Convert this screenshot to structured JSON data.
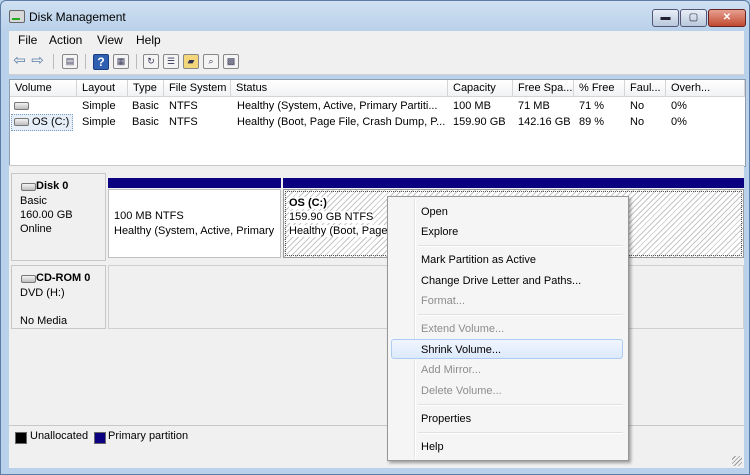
{
  "window": {
    "title": "Disk Management",
    "controls": {
      "minimize": "▬",
      "maximize": "▢",
      "close": "✕"
    }
  },
  "menu": [
    "File",
    "Action",
    "View",
    "Help"
  ],
  "toolbar_icons": [
    "back-arrow-icon",
    "forward-arrow-icon",
    "console-tree-icon",
    "help-icon",
    "refresh-icon",
    "properties-icon",
    "open-folder-icon",
    "search-icon",
    "disk-settings-icon"
  ],
  "volume_list": {
    "columns": [
      "Volume",
      "Layout",
      "Type",
      "File System",
      "Status",
      "Capacity",
      "Free Spa...",
      "% Free",
      "Faul...",
      "Overh..."
    ],
    "rows": [
      {
        "volume": "",
        "layout": "Simple",
        "type": "Basic",
        "fs": "NTFS",
        "status": "Healthy (System, Active, Primary Partiti...",
        "capacity": "100 MB",
        "free": "71 MB",
        "pct": "71 %",
        "fault": "No",
        "overhead": "0%"
      },
      {
        "volume": "OS (C:)",
        "layout": "Simple",
        "type": "Basic",
        "fs": "NTFS",
        "status": "Healthy (Boot, Page File, Crash Dump, P...",
        "capacity": "159.90 GB",
        "free": "142.16 GB",
        "pct": "89 %",
        "fault": "No",
        "overhead": "0%"
      }
    ]
  },
  "disks": [
    {
      "name": "Disk 0",
      "type": "Basic",
      "size": "160.00 GB",
      "state": "Online",
      "partitions": [
        {
          "name": "",
          "size": "100 MB NTFS",
          "status": "Healthy (System, Active, Primary"
        },
        {
          "name": "OS  (C:)",
          "size": "159.90 GB NTFS",
          "status": "Healthy (Boot, Page"
        }
      ]
    },
    {
      "name": "CD-ROM 0",
      "type": "DVD (H:)",
      "state": "No Media"
    }
  ],
  "legend": [
    {
      "label": "Unallocated",
      "color": "#000000"
    },
    {
      "label": "Primary partition",
      "color": "#0a0080"
    }
  ],
  "context_menu": {
    "items": [
      {
        "label": "Open",
        "enabled": true
      },
      {
        "label": "Explore",
        "enabled": true
      },
      {
        "label": "Mark Partition as Active",
        "enabled": true
      },
      {
        "label": "Change Drive Letter and Paths...",
        "enabled": true
      },
      {
        "label": "Format...",
        "enabled": false
      },
      {
        "label": "Extend Volume...",
        "enabled": false
      },
      {
        "label": "Shrink Volume...",
        "enabled": true,
        "highlighted": true
      },
      {
        "label": "Add Mirror...",
        "enabled": false
      },
      {
        "label": "Delete Volume...",
        "enabled": false
      },
      {
        "label": "Properties",
        "enabled": true
      },
      {
        "label": "Help",
        "enabled": true
      }
    ]
  }
}
